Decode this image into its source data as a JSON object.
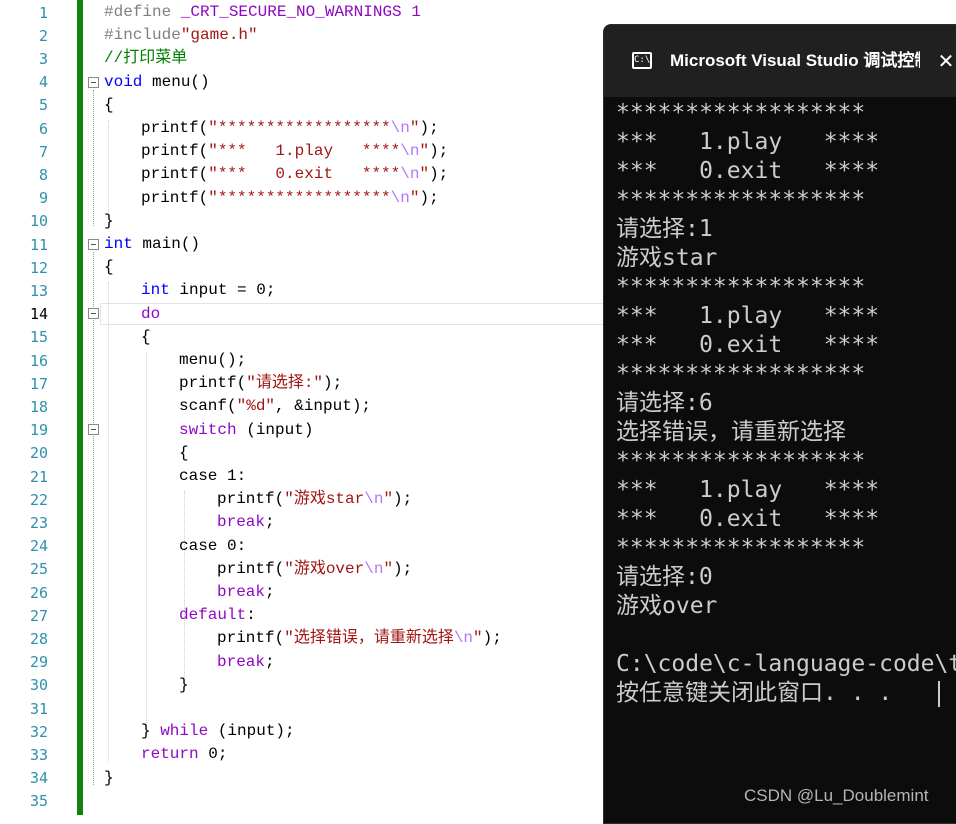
{
  "editor": {
    "line_numbers": [
      "1",
      "2",
      "3",
      "4",
      "5",
      "6",
      "7",
      "8",
      "9",
      "10",
      "11",
      "12",
      "13",
      "14",
      "15",
      "16",
      "17",
      "18",
      "19",
      "20",
      "21",
      "22",
      "23",
      "24",
      "25",
      "26",
      "27",
      "28",
      "29",
      "30",
      "31",
      "32",
      "33",
      "34",
      "35"
    ],
    "code": {
      "l1": {
        "directive": "#define",
        "rest": " _CRT_SECURE_NO_WARNINGS 1"
      },
      "l2": {
        "directive": "#include",
        "file": "\"game.h\""
      },
      "l3": {
        "comment": "//打印菜单"
      },
      "l4": {
        "type": "void",
        "rest": " menu()"
      },
      "l5": {
        "brace": "{"
      },
      "l6": {
        "fn": "printf(",
        "str": "\"******************",
        "esc": "\\n",
        "str_end": "\"",
        "end": ");"
      },
      "l7": {
        "fn": "printf(",
        "str": "\"***   1.play   ****",
        "esc": "\\n",
        "str_end": "\"",
        "end": ");"
      },
      "l8": {
        "fn": "printf(",
        "str": "\"***   0.exit   ****",
        "esc": "\\n",
        "str_end": "\"",
        "end": ");"
      },
      "l9": {
        "fn": "printf(",
        "str": "\"******************",
        "esc": "\\n",
        "str_end": "\"",
        "end": ");"
      },
      "l10": {
        "brace": "}"
      },
      "l11": {
        "type": "int",
        "rest": " main()"
      },
      "l12": {
        "brace": "{"
      },
      "l13": {
        "type": "int",
        "rest": " input = 0;"
      },
      "l14": {
        "kw": "do"
      },
      "l15": {
        "brace": "{"
      },
      "l16": {
        "text": "menu();"
      },
      "l17": {
        "fn": "printf(",
        "str": "\"请选择:\"",
        "end": ");"
      },
      "l18": {
        "fn": "scanf(",
        "str": "\"%d\"",
        "end": ", &input);"
      },
      "l19": {
        "kw": "switch",
        "rest": " (input)"
      },
      "l20": {
        "brace": "{"
      },
      "l21": {
        "kw": "case",
        "rest": " 1:"
      },
      "l22": {
        "fn": "printf(",
        "str": "\"游戏star",
        "esc": "\\n",
        "str_end": "\"",
        "end": ");"
      },
      "l23": {
        "kw": "break",
        "rest": ";"
      },
      "l24": {
        "kw": "case",
        "rest": " 0:"
      },
      "l25": {
        "fn": "printf(",
        "str": "\"游戏over",
        "esc": "\\n",
        "str_end": "\"",
        "end": ");"
      },
      "l26": {
        "kw": "break",
        "rest": ";"
      },
      "l27": {
        "kw": "default",
        "rest": ":"
      },
      "l28": {
        "fn": "printf(",
        "str": "\"选择错误，请重新选择",
        "esc": "\\n",
        "str_end": "\"",
        "end": ");"
      },
      "l29": {
        "kw": "break",
        "rest": ";"
      },
      "l30": {
        "brace": "}"
      },
      "l31": {
        "text": ""
      },
      "l32": {
        "pre": "} ",
        "kw": "while",
        "rest": " (input);"
      },
      "l33": {
        "kw": "return",
        "rest": " 0;"
      },
      "l34": {
        "brace": "}"
      },
      "l35": {
        "text": ""
      }
    }
  },
  "console": {
    "title": "Microsoft Visual Studio 调试控制台",
    "icon": "console-icon",
    "icon_glyph": "C:\\",
    "close_glyph": "✕",
    "lines": [
      "******************",
      "***   1.play   ****",
      "***   0.exit   ****",
      "******************",
      "请选择:1",
      "游戏star",
      "******************",
      "***   1.play   ****",
      "***   0.exit   ****",
      "******************",
      "请选择:6",
      "选择错误，请重新选择",
      "******************",
      "***   1.play   ****",
      "***   0.exit   ****",
      "******************",
      "请选择:0",
      "游戏over",
      "",
      "C:\\code\\c-language-code\\t",
      "按任意键关闭此窗口. . ."
    ]
  },
  "watermark": "CSDN @Lu_Doublemint",
  "colors": {
    "line_number": "#2b91af",
    "keyword": "#0000ff",
    "control_keyword": "#8f08c4",
    "string": "#a31515",
    "comment": "#008000",
    "change_bar": "#108010",
    "console_bg": "#0c0c0c",
    "console_text": "#cccccc"
  }
}
